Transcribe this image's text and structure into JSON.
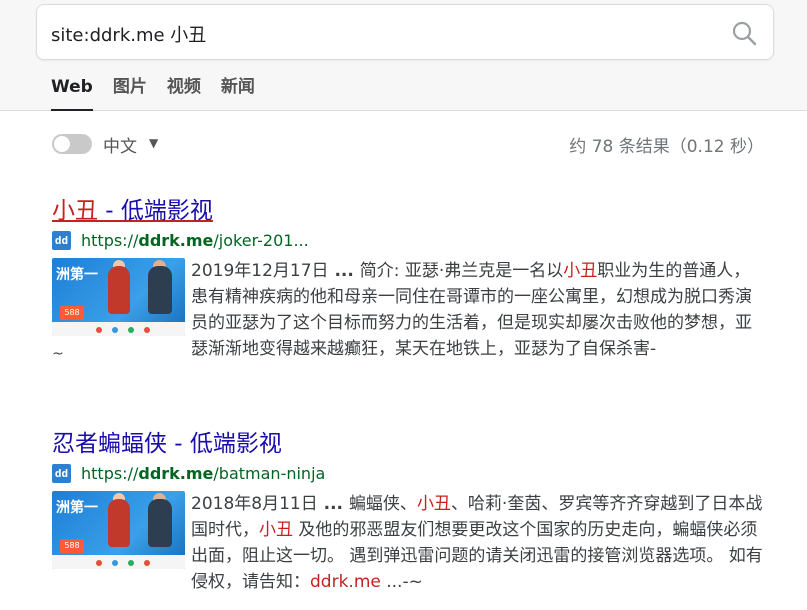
{
  "search": {
    "query": "site:ddrk.me 小丑"
  },
  "tabs": [
    {
      "label": "Web",
      "active": true
    },
    {
      "label": "图片"
    },
    {
      "label": "视频"
    },
    {
      "label": "新闻"
    }
  ],
  "toolbar": {
    "language": "中文",
    "stats": "约 78 条结果（0.12 秒）"
  },
  "results": [
    {
      "title_hl": "小丑",
      "title_rest": " - 低端影视",
      "url_prefix": "https://",
      "url_domain": "ddrk.me",
      "url_path": "/joker-201...",
      "snippet": {
        "date": "2019年12月17日",
        "sep": " ... ",
        "p1": "简介: 亚瑟·弗兰克是一名以",
        "hl1": "小丑",
        "p2": "职业为生的普通人，患有精神疾病的他和母亲一同住在哥谭市的一座公寓里，幻想成为脱口秀演员的亚瑟为了这个目标而努力的生活着，但是现实却屡次击败他的梦想，亚瑟渐渐地变得越来越癫狂，某天在地铁上，亚瑟为了自保杀害-"
      },
      "trailing": "~"
    },
    {
      "title": "忍者蝙蝠侠 - 低端影视",
      "url_prefix": "https://",
      "url_domain": "ddrk.me",
      "url_path": "/batman-ninja",
      "snippet": {
        "date": "2018年8月11日",
        "sep": " ... ",
        "p1": "蝙蝠侠、",
        "hl1": "小丑",
        "p2": "、哈莉·奎茵、罗宾等齐齐穿越到了日本战国时代，",
        "hl2": "小丑",
        "p3": " 及他的邪恶盟友们想要更改这个国家的历史走向，蝙蝠侠必须出面，阻止这一切。 遇到弹迅雷问题的请关闭迅雷的接管浏览器选项。 如有侵权，请告知：",
        "hl3": "ddrk.me",
        "p4": " ...-~"
      }
    }
  ],
  "favicon_text": "dd",
  "thumb": {
    "label": "洲第一",
    "badge": "588"
  },
  "colors": {
    "link": "#1a0dab",
    "highlight": "#c5221f",
    "url": "#006621"
  }
}
